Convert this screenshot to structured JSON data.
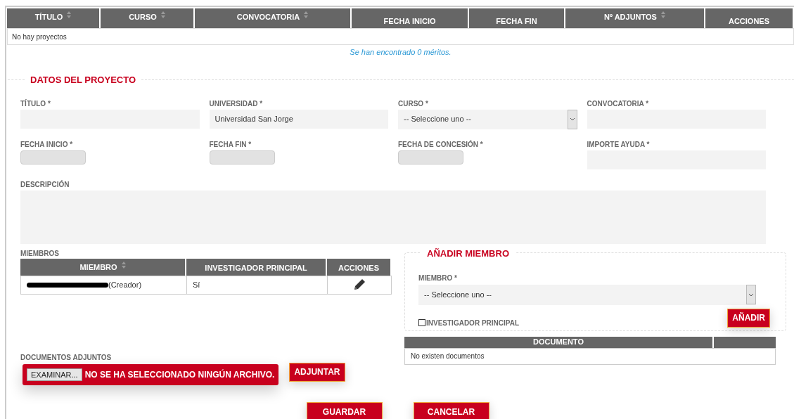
{
  "projects_table": {
    "columns": [
      {
        "label": "TÍTULO",
        "sortable": true
      },
      {
        "label": "CURSO",
        "sortable": true
      },
      {
        "label": "CONVOCATORIA",
        "sortable": true
      },
      {
        "label": "FECHA INICIO",
        "sortable": false
      },
      {
        "label": "FECHA FIN",
        "sortable": false
      },
      {
        "label": "Nº ADJUNTOS",
        "sortable": true
      },
      {
        "label": "ACCIONES",
        "sortable": false
      }
    ],
    "empty_message": "No hay proyectos"
  },
  "results_message": "Se han encontrado 0 méritos.",
  "project_section": {
    "legend": "DATOS DEL PROYECTO",
    "fields": [
      {
        "kind": "text",
        "label": "TÍTULO *"
      },
      {
        "kind": "text",
        "label": "UNIVERSIDAD *",
        "value": "Universidad San Jorge"
      },
      {
        "kind": "select",
        "label": "CURSO *",
        "value": "-- Seleccione uno --"
      },
      {
        "kind": "text",
        "label": "CONVOCATORIA *"
      },
      {
        "kind": "date",
        "label": "FECHA INICIO *"
      },
      {
        "kind": "date",
        "label": "FECHA FIN *"
      },
      {
        "kind": "date",
        "label": "FECHA DE CONCESIÓN *"
      },
      {
        "kind": "text",
        "label": "IMPORTE AYUDA *"
      },
      {
        "kind": "textarea",
        "label": "DESCRIPCIÓN"
      }
    ]
  },
  "members": {
    "label": "MIEMBROS",
    "columns": [
      {
        "label": "MIEMBRO",
        "sortable": true
      },
      {
        "label": "INVESTIGADOR PRINCIPAL",
        "sortable": false
      },
      {
        "label": "ACCIONES",
        "sortable": false
      }
    ],
    "rows": [
      {
        "member": "(Creador)",
        "redacted": true,
        "principal": "Sí"
      }
    ]
  },
  "add_member": {
    "legend": "AÑADIR MIEMBRO",
    "member_label": "MIEMBRO *",
    "member_value": "-- Seleccione uno --",
    "checkbox": {
      "label": "INVESTIGADOR PRINCIPAL",
      "checked": false
    },
    "button": "AÑADIR"
  },
  "attachments": {
    "label": "DOCUMENTOS ADJUNTOS",
    "browse_button": "EXAMINAR...",
    "file_status": "NO SE HA SELECCIONADO NINGÚN ARCHIVO.",
    "attach_button": "ADJUNTAR"
  },
  "documents_table": {
    "columns": [
      "DOCUMENTO"
    ],
    "empty_message": "No existen documentos"
  },
  "buttons": [
    "GUARDAR",
    "CANCELAR"
  ]
}
